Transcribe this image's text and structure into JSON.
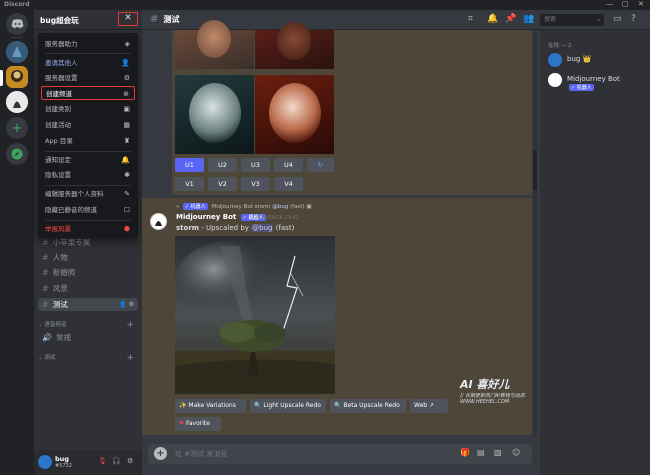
{
  "app": {
    "name": "Discord"
  },
  "window_controls": {
    "minimize": "—",
    "maximize": "□",
    "close": "✕"
  },
  "guild": {
    "name": "bug超会玩",
    "close_glyph": "✕"
  },
  "menu": {
    "items": [
      {
        "label": "服务器助力",
        "icon": "boost-icon",
        "glyph": "◈",
        "style": ""
      },
      {
        "label": "邀请其他人",
        "icon": "add-person-icon",
        "glyph": "👤",
        "style": "blue"
      },
      {
        "label": "服务器设置",
        "icon": "gear-icon",
        "glyph": "⚙",
        "style": ""
      },
      {
        "label": "创建频道",
        "icon": "plus-circle-icon",
        "glyph": "⊕",
        "style": "hl"
      },
      {
        "label": "创建类别",
        "icon": "folder-plus-icon",
        "glyph": "▣",
        "style": ""
      },
      {
        "label": "创建活动",
        "icon": "calendar-icon",
        "glyph": "▦",
        "style": ""
      },
      {
        "label": "App 目录",
        "icon": "robot-icon",
        "glyph": "♜",
        "style": ""
      },
      {
        "label": "通知设定",
        "icon": "bell-icon",
        "glyph": "🔔",
        "style": ""
      },
      {
        "label": "隐私设置",
        "icon": "shield-icon",
        "glyph": "✱",
        "style": ""
      },
      {
        "label": "编辑服务器个人资料",
        "icon": "pencil-icon",
        "glyph": "✎",
        "style": ""
      },
      {
        "label": "隐藏已静音的频道",
        "icon": "checkbox-icon",
        "glyph": "☐",
        "style": ""
      },
      {
        "label": "举报风暴",
        "icon": "report-icon",
        "glyph": "⬢",
        "style": "red"
      }
    ]
  },
  "channels": {
    "list": [
      {
        "name": "小苹果专属"
      },
      {
        "name": "人物"
      },
      {
        "name": "新婚照"
      },
      {
        "name": "风景"
      },
      {
        "name": "测试"
      }
    ],
    "categories": [
      {
        "label": "语音频道",
        "plus": "+"
      },
      {
        "label": "测试",
        "plus": "+"
      }
    ],
    "voice": {
      "name": "常规",
      "glyph": "🔊"
    }
  },
  "user": {
    "name": "bug",
    "tag": "#5732"
  },
  "topbar": {
    "channel": "测试",
    "hash": "#",
    "search_placeholder": "搜索",
    "search_glyph": "⌕"
  },
  "upscale_buttons": [
    "U1",
    "U2",
    "U3",
    "U4"
  ],
  "variation_buttons": [
    "V1",
    "V2",
    "V3",
    "V4"
  ],
  "refresh_glyph": "↻",
  "message": {
    "reply_author": "Midjourney Bot",
    "reply_tag": "✓ 机器人",
    "reply_word": "storm",
    "reply_mention": "@bug",
    "reply_mode": "(fast)",
    "author": "Midjourney Bot",
    "author_tag": "✓ 机器人",
    "time": "2023/04/16 23:42",
    "prompt": "storm",
    "body": " - Upscaled by ",
    "mention": "@bug",
    "mode": " (fast)"
  },
  "action_buttons": [
    {
      "label": "Make Variations",
      "glyph": "✨"
    },
    {
      "label": "Light Upscale Redo",
      "glyph": "🔍"
    },
    {
      "label": "Beta Upscale Redo",
      "glyph": "🔍"
    },
    {
      "label": "Web",
      "glyph": "↗"
    },
    {
      "label": "Favorite",
      "glyph": "❤"
    }
  ],
  "watermark": {
    "brand": "AI 喜好儿",
    "slogan": "// 长期更新热门AI教程与动态",
    "url": "WWW.HEEHEL.COM"
  },
  "composer": {
    "placeholder": "给 #测试 发消息",
    "plus": "+"
  },
  "members": {
    "header": "在线 — 2",
    "list": [
      {
        "name": "bug",
        "badge": "👑",
        "color": "#2c76c9"
      },
      {
        "name": "Midjourney Bot",
        "badge": "✓ 机器人",
        "color": "#ffffff"
      }
    ]
  },
  "colors": {
    "accent": "#5865f2",
    "highlight_border": "#e03b3b",
    "sidebar": "#2f3136",
    "chat": "#36393f",
    "message_tint": "#4e4639"
  }
}
